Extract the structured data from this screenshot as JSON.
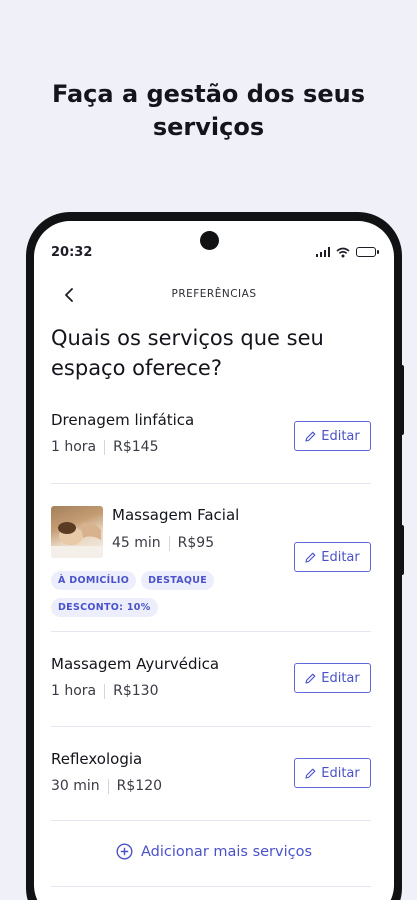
{
  "headline": {
    "line1": "Faça a gestão dos seus",
    "line2": "serviços"
  },
  "status_bar": {
    "time": "20:32"
  },
  "topbar": {
    "title": "PREFERÊNCIAS"
  },
  "question": {
    "line1": "Quais os serviços que seu",
    "line2": "espaço oferece?"
  },
  "services": [
    {
      "name": "Drenagem linfática",
      "duration": "1 hora",
      "price": "R$145",
      "edit_label": "Editar"
    },
    {
      "name": "Massagem Facial",
      "duration": "45 min",
      "price": "R$95",
      "edit_label": "Editar",
      "tags": [
        "À DOMICÍLIO",
        "DESTAQUE",
        "DESCONTO: 10%"
      ]
    },
    {
      "name": "Massagem Ayurvédica",
      "duration": "1 hora",
      "price": "R$130",
      "edit_label": "Editar"
    },
    {
      "name": "Reflexologia",
      "duration": "30 min",
      "price": "R$120",
      "edit_label": "Editar"
    }
  ],
  "add_more": {
    "label": "Adicionar mais serviços"
  },
  "colors": {
    "accent": "#4b52c9",
    "background": "#eff0f8",
    "tag_bg": "#eceefc"
  },
  "icons": [
    "back-chevron-icon",
    "signal-icon",
    "wifi-icon",
    "battery-icon",
    "pencil-icon",
    "plus-circle-icon"
  ]
}
